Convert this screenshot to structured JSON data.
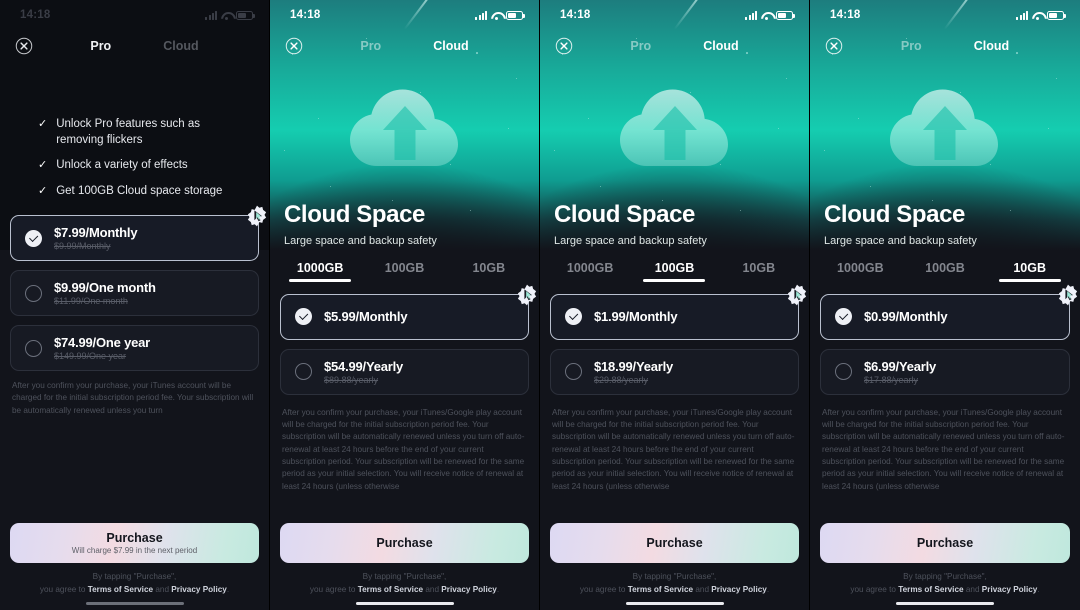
{
  "meta": {
    "app_title": "Cloud Space Subscription Paywall",
    "accent_teal": "#15cdb0",
    "card_bg": "#171a23",
    "selected_border": "#b9c0cf"
  },
  "status_bar": {
    "time": "14:18",
    "signal_icon": "cellular-signal-icon",
    "wifi_icon": "wifi-icon",
    "battery_icon": "battery-icon"
  },
  "nav": {
    "close_icon": "close-icon",
    "tab_pro": "Pro",
    "tab_cloud": "Cloud"
  },
  "hero": {
    "title": "Cloud Space",
    "subtitle": "Large space and backup safety",
    "icon": "cloud-upload-icon"
  },
  "size_tabs": [
    "1000GB",
    "100GB",
    "10GB"
  ],
  "purchase": {
    "label": "Purchase",
    "cursor_icon": "cursor-pointer-icon"
  },
  "agree": {
    "line1": "By tapping \"Purchase\",",
    "prefix": "you agree to ",
    "terms": "Terms of Service",
    "middle": " and ",
    "privacy": "Privacy Policy",
    "suffix": "."
  },
  "legal_itunes": "After you confirm your purchase, your iTunes account will be charged for the initial subscription period fee. Your subscription will be automatically renewed unless you turn",
  "legal_google": "After you confirm your purchase, your iTunes/Google play account will be charged for the initial subscription period fee. Your subscription will be automatically renewed unless you turn off auto-renewal at least 24 hours before the end of your current subscription period. Your subscription will be renewed for the same period as your initial selection. You will receive notice of renewal at least 24 hours (unless otherwise",
  "panels": [
    {
      "id": "pro-tab-panel",
      "variant": "pro",
      "dimmed": true,
      "active_nav_tab": "Pro",
      "features": [
        "Unlock Pro features such as removing flickers",
        "Unlock a variety of effects",
        "Get 100GB Cloud space storage"
      ],
      "plans": [
        {
          "price": "$7.99/Monthly",
          "old": "$9.99/Monthly",
          "selected": true
        },
        {
          "price": "$9.99/One month",
          "old": "$11.99/One month",
          "selected": false
        },
        {
          "price": "$74.99/One year",
          "old": "$149.99/One year",
          "selected": false
        }
      ],
      "purchase_sub": "Will charge $7.99 in the next period"
    },
    {
      "id": "cloud-1000gb-panel",
      "variant": "cloud",
      "dimmed": false,
      "active_nav_tab": "Cloud",
      "active_size": "1000GB",
      "plans": [
        {
          "price": "$5.99/Monthly",
          "old": "",
          "selected": true
        },
        {
          "price": "$54.99/Yearly",
          "old": "$89.88/yearly",
          "selected": false
        }
      ],
      "purchase_sub": ""
    },
    {
      "id": "cloud-100gb-panel",
      "variant": "cloud",
      "dimmed": false,
      "active_nav_tab": "Cloud",
      "active_size": "100GB",
      "plans": [
        {
          "price": "$1.99/Monthly",
          "old": "",
          "selected": true
        },
        {
          "price": "$18.99/Yearly",
          "old": "$29.88/yearly",
          "selected": false
        }
      ],
      "purchase_sub": ""
    },
    {
      "id": "cloud-10gb-panel",
      "variant": "cloud",
      "dimmed": false,
      "active_nav_tab": "Cloud",
      "active_size": "10GB",
      "plans": [
        {
          "price": "$0.99/Monthly",
          "old": "",
          "selected": true
        },
        {
          "price": "$6.99/Yearly",
          "old": "$17.88/yearly",
          "selected": false
        }
      ],
      "purchase_sub": ""
    }
  ]
}
